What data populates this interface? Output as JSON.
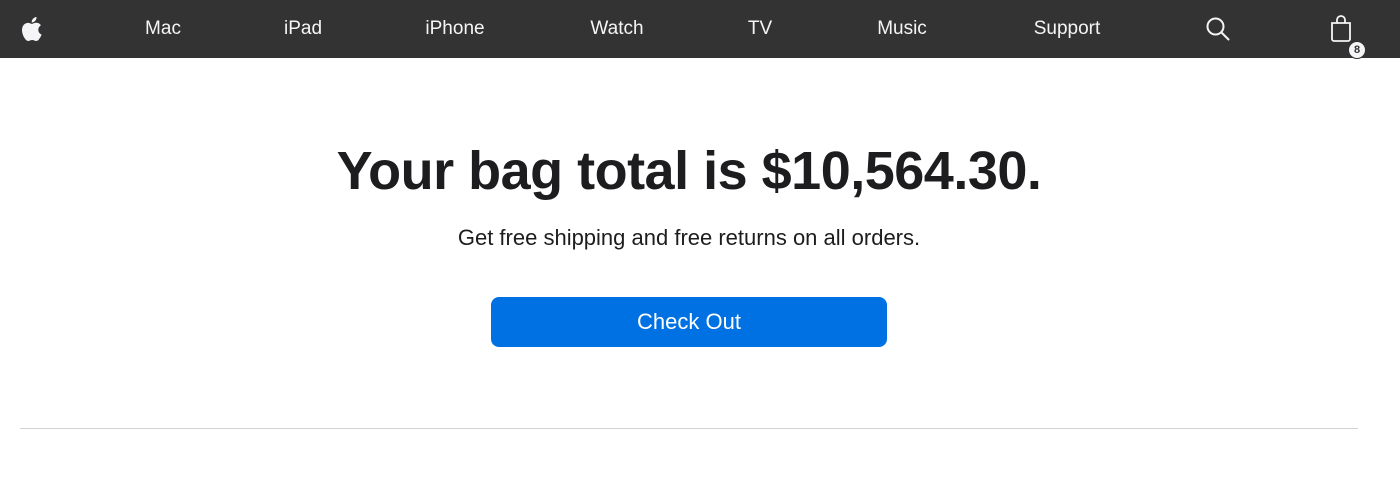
{
  "nav": {
    "logo_icon": "apple-logo-icon",
    "items": [
      {
        "label": "Mac"
      },
      {
        "label": "iPad"
      },
      {
        "label": "iPhone"
      },
      {
        "label": "Watch"
      },
      {
        "label": "TV"
      },
      {
        "label": "Music"
      },
      {
        "label": "Support"
      }
    ],
    "search_icon": "search-icon",
    "bag_icon": "shopping-bag-icon",
    "bag_count": "8"
  },
  "main": {
    "headline": "Your bag total is $10,564.30.",
    "subhead": "Get free shipping and free returns on all orders.",
    "checkout_label": "Check Out"
  },
  "colors": {
    "nav_background": "#333333",
    "nav_text": "#f5f5f7",
    "button_blue": "#0071e3",
    "text_primary": "#1d1d1f",
    "divider": "#d2d2d7"
  }
}
